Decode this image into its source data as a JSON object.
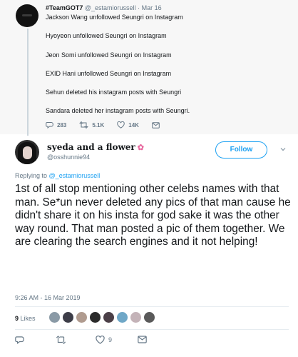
{
  "parent_tweet": {
    "display_name": "#TeamGOT7",
    "handle": "@_estamiorussell",
    "date": "Mar 16",
    "lines": [
      "Jackson Wang unfollowed Seungri on Instagram",
      "Hyoyeon unfollowed Seungri on Instagram",
      "Jeon Somi unfollowed Seungri on Instagram",
      "EXID Hani unfollowed Seungri on Instagram",
      "Sehun deleted his instagram posts with Seungri",
      "Sandara deleted her instagram posts with Seungri."
    ],
    "actions": {
      "replies": "283",
      "retweets": "5.1K",
      "likes": "14K"
    }
  },
  "tweet": {
    "display_name": "syeda and a flower",
    "handle": "@osshunnie94",
    "follow_label": "Follow",
    "replying_prefix": "Replying to",
    "replying_to": "@_estamiorussell",
    "text": "1st of all stop mentioning other celebs names with that man. Se*un never deleted any pics of that man cause he didn't share it on his insta for god sake it was the other way round. That man posted a pic of them together. We are clearing the search engines and it not helping!",
    "timestamp": "9:26 AM - 16 Mar 2019",
    "likes_count": "9",
    "likes_label": "Likes",
    "actions": {
      "likes": "9"
    }
  },
  "colors": {
    "accent": "#1da1f2",
    "secondary_text": "#657786",
    "parent_background": "#f7f7f7"
  },
  "icons": [
    "reply-icon",
    "retweet-icon",
    "like-icon",
    "message-icon",
    "chevron-down-icon"
  ]
}
